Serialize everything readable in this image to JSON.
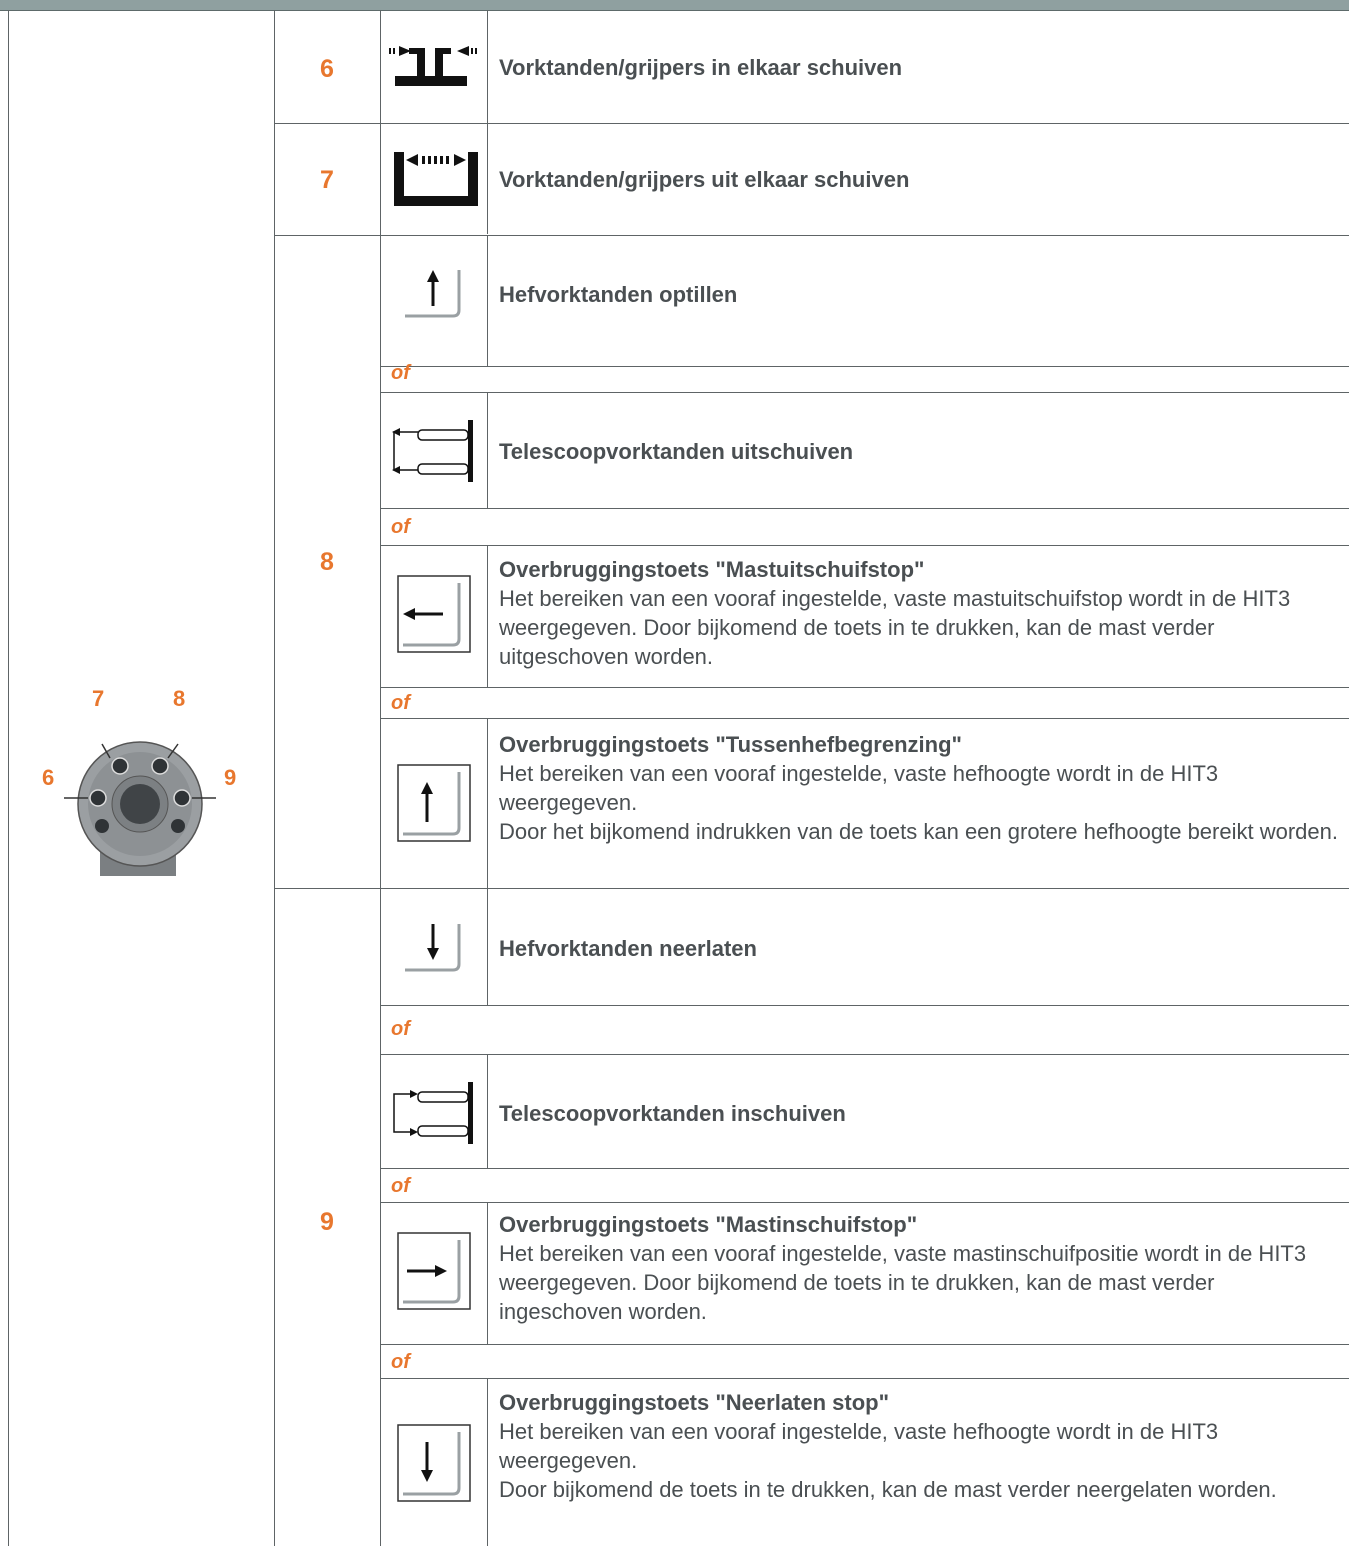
{
  "rows": {
    "r6": {
      "num": "6",
      "label": "Vorktanden/grijpers in elkaar schuiven"
    },
    "r7": {
      "num": "7",
      "label": "Vorktanden/grijpers uit elkaar schuiven"
    },
    "r8": {
      "num": "8",
      "lift_label": "Hefvorktanden optillen",
      "tele_out_label": "Telescoopvorktanden uitschuiven",
      "bypass_mast_out": {
        "title": "Overbruggingstoets \"Mastuitschuifstop\"",
        "text": "Het bereiken van een vooraf ingestelde, vaste mastuitschuifstop wordt in de HIT3 weergegeven. Door bijkomend de toets in te drukken, kan de mast verder uitgeschoven worden."
      },
      "bypass_lift": {
        "title": "Overbruggingstoets \"Tussenhefbegrenzing\"",
        "text1": "Het bereiken van een vooraf ingestelde, vaste hefhoogte wordt in de HIT3 weergegeven.",
        "text2": "Door het bijkomend indrukken van de toets kan een grotere hefhoogte bereikt worden."
      }
    },
    "r9": {
      "num": "9",
      "lower_label": "Hefvorktanden neerlaten",
      "tele_in_label": "Telescoopvorktanden inschuiven",
      "bypass_mast_in": {
        "title": "Overbruggingstoets \"Mastinschuifstop\"",
        "text": "Het bereiken van een vooraf ingestelde, vaste mastinschuifpositie wordt in de HIT3 weergegeven. Door bijkomend de toets in te drukken, kan de mast verder ingeschoven worden."
      },
      "bypass_lower": {
        "title": "Overbruggingstoets \"Neerlaten stop\"",
        "text1": "Het bereiken van een vooraf ingestelde, vaste hefhoogte wordt in de HIT3 weergegeven.",
        "text2": "Door bijkomend de toets in te drukken, kan de mast verder neergelaten worden."
      }
    }
  },
  "or_word": "of",
  "joystick_labels": {
    "b6": "6",
    "b7": "7",
    "b8": "8",
    "b9": "9"
  },
  "colors": {
    "accent": "#e8772e",
    "text": "#4a4f52",
    "header_bar": "#8fa0a0"
  }
}
